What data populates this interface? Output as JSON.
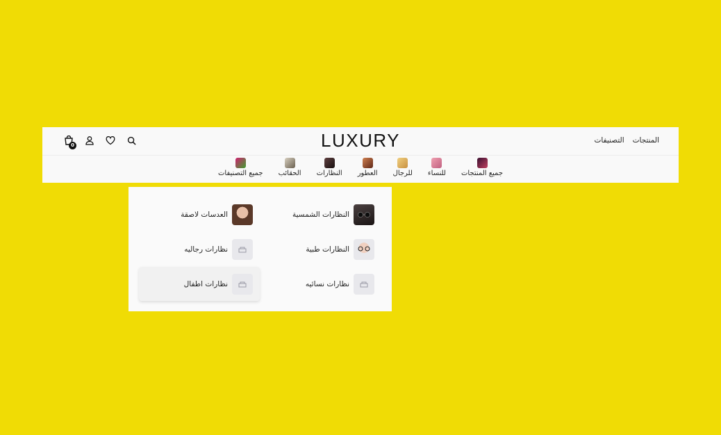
{
  "header": {
    "logo": "LUXURY",
    "nav": [
      "المنتجات",
      "التصنيفات"
    ],
    "cart_count": "0",
    "icons": [
      "cart-icon",
      "user-icon",
      "heart-icon",
      "search-icon"
    ]
  },
  "categories": [
    {
      "label": "جميع المنتجات",
      "color": "#7a2040"
    },
    {
      "label": "للنساء",
      "color": "#d08090"
    },
    {
      "label": "للرجال",
      "color": "#e8c060"
    },
    {
      "label": "العطور",
      "color": "#a05030"
    },
    {
      "label": "النظارات",
      "color": "#302828"
    },
    {
      "label": "الحقائب",
      "color": "#9a9080"
    },
    {
      "label": "جميع التصنيفات",
      "color": "#a02080"
    }
  ],
  "dropdown": {
    "items": [
      {
        "label": "النظارات الشمسية",
        "has_image": true
      },
      {
        "label": "العدسات لاصقة",
        "has_image": true
      },
      {
        "label": "النظارات طبية",
        "has_image": true
      },
      {
        "label": "نظارات رجاليه",
        "has_image": false
      },
      {
        "label": "نظارات نسائيه",
        "has_image": false
      },
      {
        "label": "نظارات اطفال",
        "has_image": false
      }
    ]
  },
  "colors": {
    "background": "#f0dc05",
    "panel": "#f9f9f9"
  }
}
